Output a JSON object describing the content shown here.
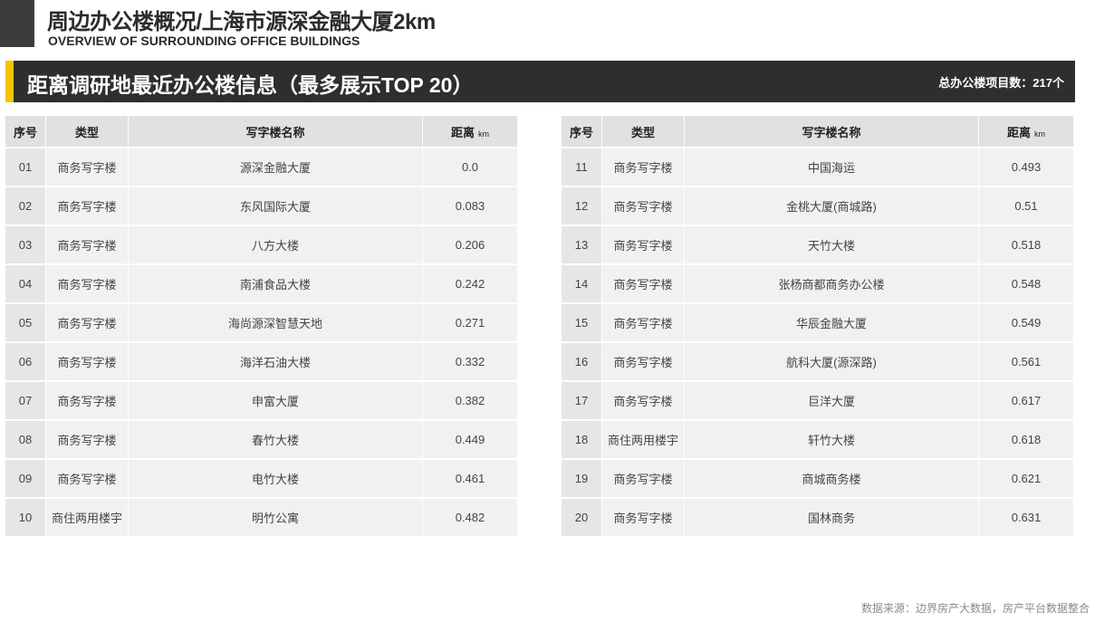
{
  "header": {
    "title": "周边办公楼概况/上海市源深金融大厦2km",
    "subtitle": "OVERVIEW OF SURROUNDING OFFICE BUILDINGS"
  },
  "section": {
    "title": "距离调研地最近办公楼信息（最多展示TOP 20）",
    "count_label": "总办公楼项目数：217个"
  },
  "table": {
    "headers": {
      "no": "序号",
      "type": "类型",
      "name": "写字楼名称",
      "distance": "距离",
      "unit": "km"
    },
    "left_rows": [
      {
        "no": "01",
        "type": "商务写字楼",
        "name": "源深金融大厦",
        "distance": "0.0"
      },
      {
        "no": "02",
        "type": "商务写字楼",
        "name": "东风国际大厦",
        "distance": "0.083"
      },
      {
        "no": "03",
        "type": "商务写字楼",
        "name": "八方大楼",
        "distance": "0.206"
      },
      {
        "no": "04",
        "type": "商务写字楼",
        "name": "南浦食品大楼",
        "distance": "0.242"
      },
      {
        "no": "05",
        "type": "商务写字楼",
        "name": "海尚源深智慧天地",
        "distance": "0.271"
      },
      {
        "no": "06",
        "type": "商务写字楼",
        "name": "海洋石油大楼",
        "distance": "0.332"
      },
      {
        "no": "07",
        "type": "商务写字楼",
        "name": "申富大厦",
        "distance": "0.382"
      },
      {
        "no": "08",
        "type": "商务写字楼",
        "name": "春竹大楼",
        "distance": "0.449"
      },
      {
        "no": "09",
        "type": "商务写字楼",
        "name": "电竹大楼",
        "distance": "0.461"
      },
      {
        "no": "10",
        "type": "商住两用楼宇",
        "name": "明竹公寓",
        "distance": "0.482"
      }
    ],
    "right_rows": [
      {
        "no": "11",
        "type": "商务写字楼",
        "name": "中国海运",
        "distance": "0.493"
      },
      {
        "no": "12",
        "type": "商务写字楼",
        "name": "金桃大厦(商城路)",
        "distance": "0.51"
      },
      {
        "no": "13",
        "type": "商务写字楼",
        "name": "天竹大楼",
        "distance": "0.518"
      },
      {
        "no": "14",
        "type": "商务写字楼",
        "name": "张杨商都商务办公楼",
        "distance": "0.548"
      },
      {
        "no": "15",
        "type": "商务写字楼",
        "name": "华辰金融大厦",
        "distance": "0.549"
      },
      {
        "no": "16",
        "type": "商务写字楼",
        "name": "航科大厦(源深路)",
        "distance": "0.561"
      },
      {
        "no": "17",
        "type": "商务写字楼",
        "name": "巨洋大厦",
        "distance": "0.617"
      },
      {
        "no": "18",
        "type": "商住两用楼宇",
        "name": "轩竹大楼",
        "distance": "0.618"
      },
      {
        "no": "19",
        "type": "商务写字楼",
        "name": "商城商务楼",
        "distance": "0.621"
      },
      {
        "no": "20",
        "type": "商务写字楼",
        "name": "国林商务",
        "distance": "0.631"
      }
    ]
  },
  "footer": {
    "source": "数据来源：边界房产大数据，房产平台数据整合"
  },
  "colors": {
    "accent": "#f5c400",
    "bar": "#2e2e2e",
    "header_cell": "#e1e1e1",
    "row_cell": "#f1f1f1"
  }
}
